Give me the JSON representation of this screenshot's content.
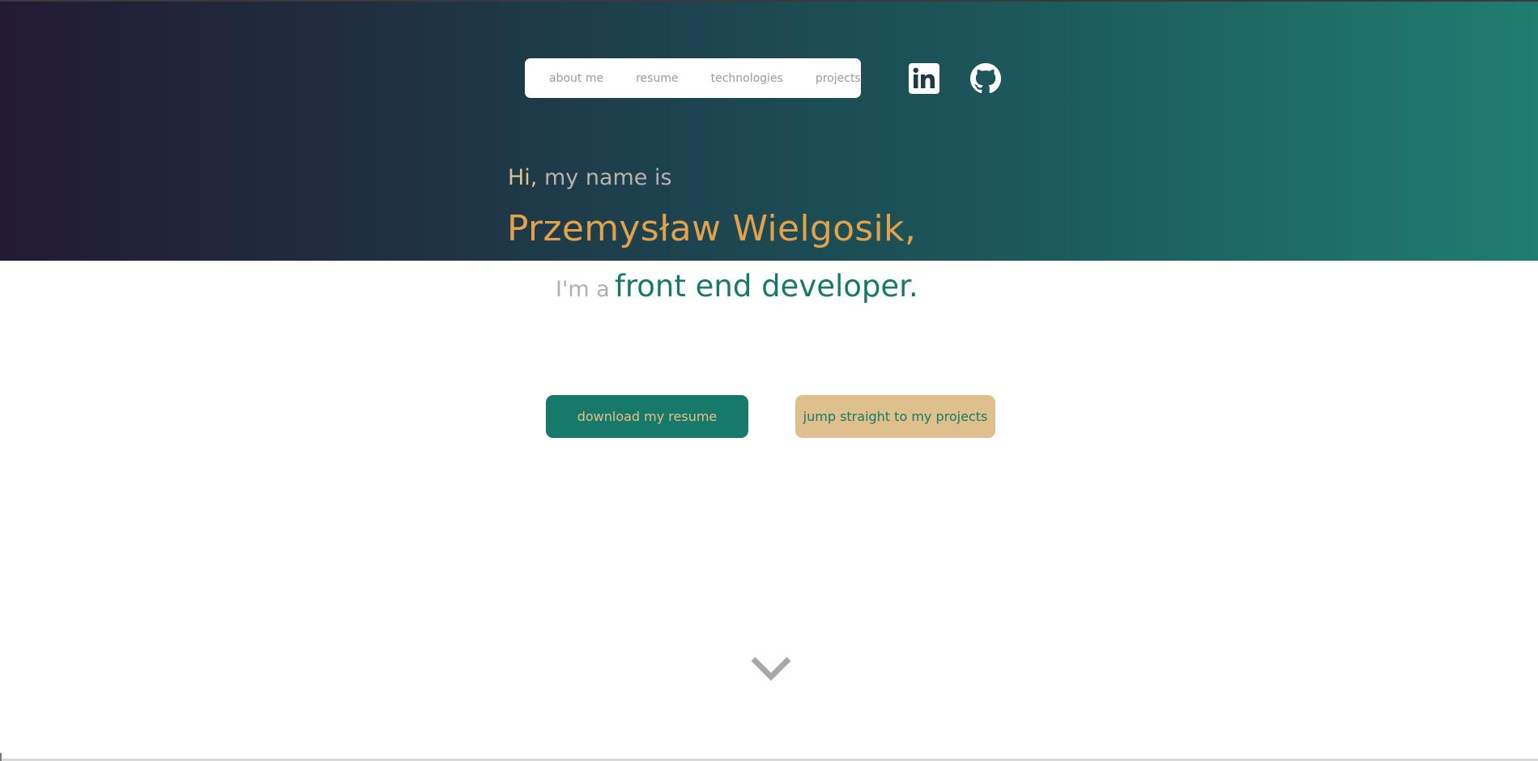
{
  "nav": {
    "items": [
      {
        "label": "about me"
      },
      {
        "label": "resume"
      },
      {
        "label": "technologies"
      },
      {
        "label": "projects"
      }
    ]
  },
  "social": {
    "linkedin_icon": "linkedin-icon",
    "github_icon": "github-icon"
  },
  "hero": {
    "greeting_hi": "Hi,",
    "greeting_rest": " my name is",
    "name": "Przemysław Wielgosik,",
    "role_prefix": "I'm a",
    "role_title": "front end developer."
  },
  "actions": {
    "download_resume": "download my resume",
    "jump_projects": "jump straight to my projects"
  },
  "scroll": {
    "icon": "chevron-down-icon"
  },
  "colors": {
    "accent_green": "#17796a",
    "accent_gold": "#dfc08d",
    "name_orange": "#e2a24c",
    "gradient_start": "#241a35",
    "gradient_end": "#207d70"
  }
}
